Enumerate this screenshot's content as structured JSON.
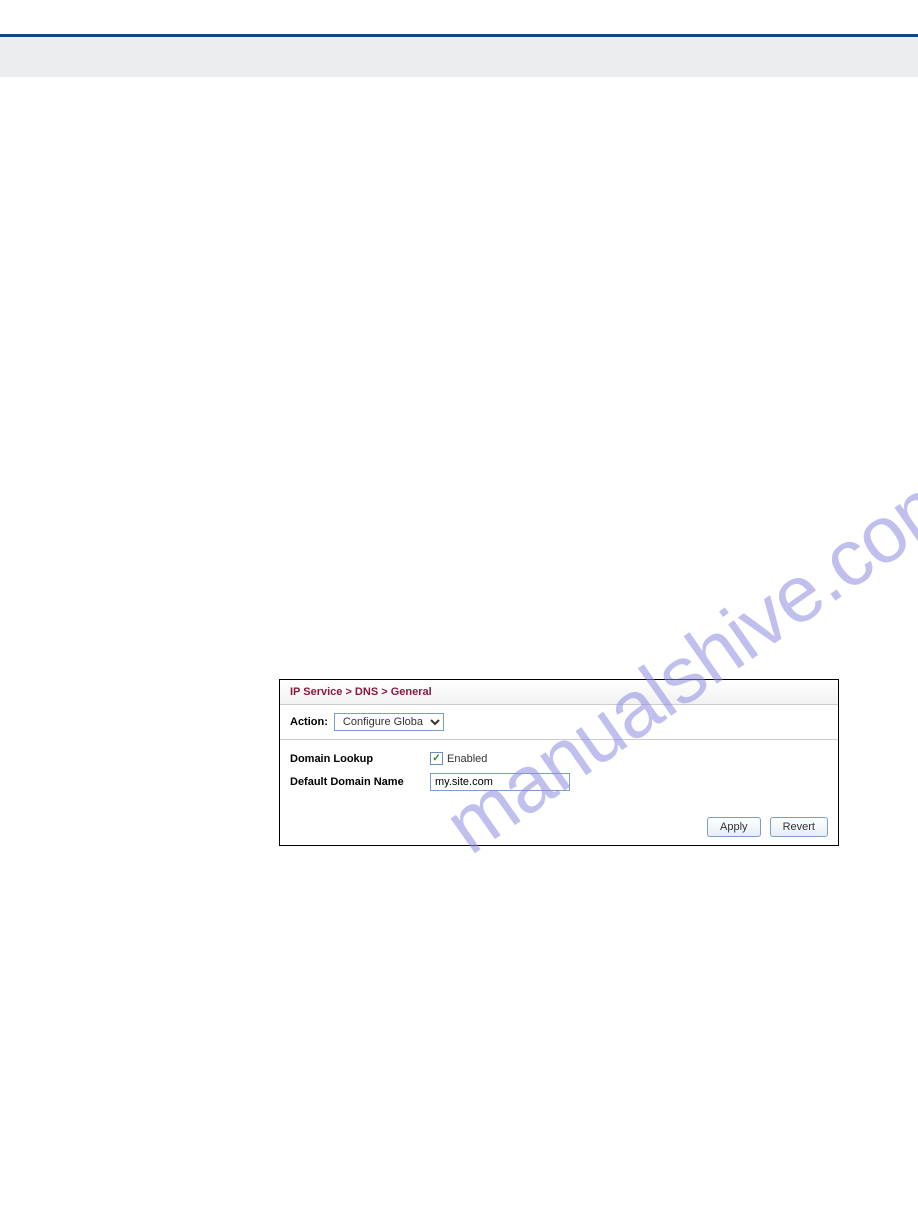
{
  "watermark": "manualshive.com",
  "panel": {
    "breadcrumb": "IP Service > DNS > General",
    "action_label": "Action:",
    "action_value": "Configure Global",
    "domain_lookup_label": "Domain Lookup",
    "domain_lookup_checked": true,
    "enabled_label": "Enabled",
    "default_domain_label": "Default Domain Name",
    "default_domain_value": "my.site.com",
    "apply_label": "Apply",
    "revert_label": "Revert"
  }
}
